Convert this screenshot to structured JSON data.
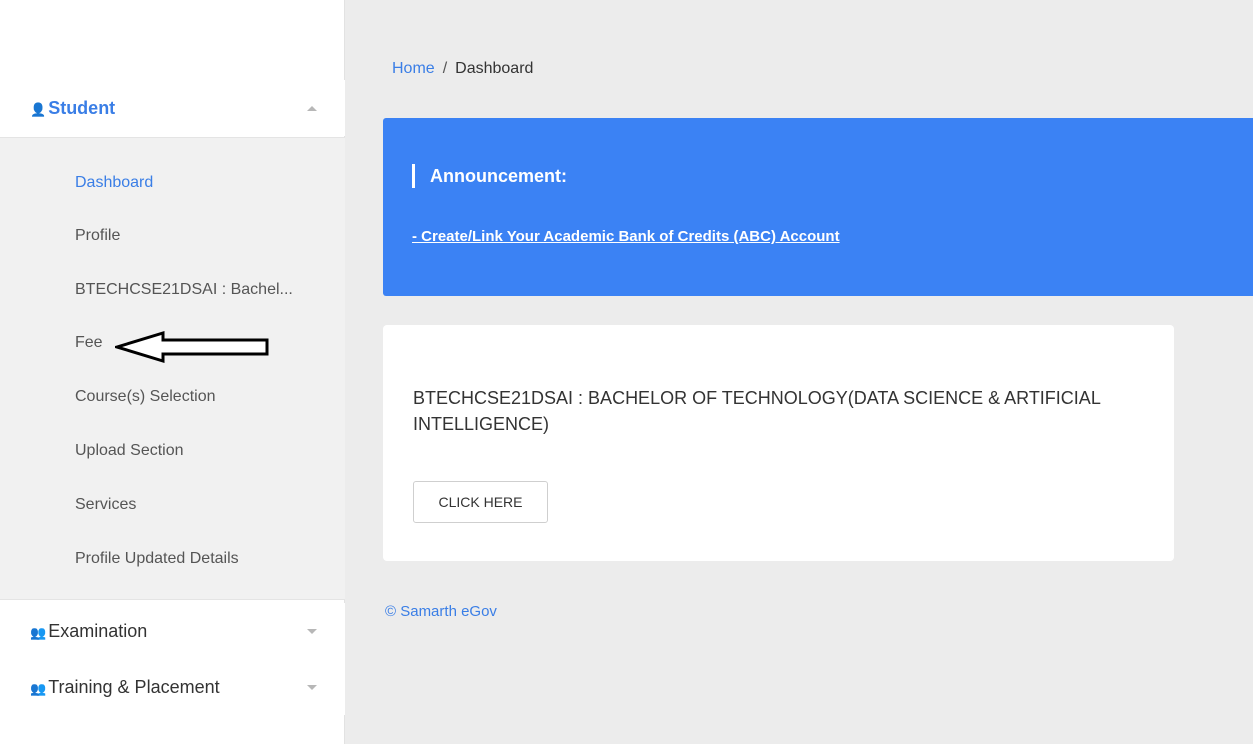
{
  "sidebar": {
    "student_label": "Student",
    "student_icon": "person-icon",
    "items": [
      {
        "label": "Dashboard",
        "current": true
      },
      {
        "label": "Profile"
      },
      {
        "label": "BTECHCSE21DSAI : Bachel..."
      },
      {
        "label": "Fee"
      },
      {
        "label": "Course(s) Selection"
      },
      {
        "label": "Upload Section"
      },
      {
        "label": "Services"
      },
      {
        "label": "Profile Updated Details"
      }
    ],
    "examination_label": "Examination",
    "training_label": "Training & Placement",
    "group_icon": "people-icon"
  },
  "breadcrumb": {
    "home": "Home",
    "separator": "/",
    "current": "Dashboard"
  },
  "announcement": {
    "title": "Announcement:",
    "link": "- Create/Link Your Academic Bank of Credits (ABC) Account"
  },
  "program_card": {
    "title": "BTECHCSE21DSAI : BACHELOR OF TECHNOLOGY(DATA SCIENCE & ARTIFICIAL INTELLIGENCE)",
    "button": "CLICK HERE"
  },
  "footer": {
    "text": "© Samarth eGov"
  },
  "colors": {
    "accent": "#3a7ee6",
    "announcement_bg": "#3b82f4",
    "page_bg": "#ececec"
  }
}
